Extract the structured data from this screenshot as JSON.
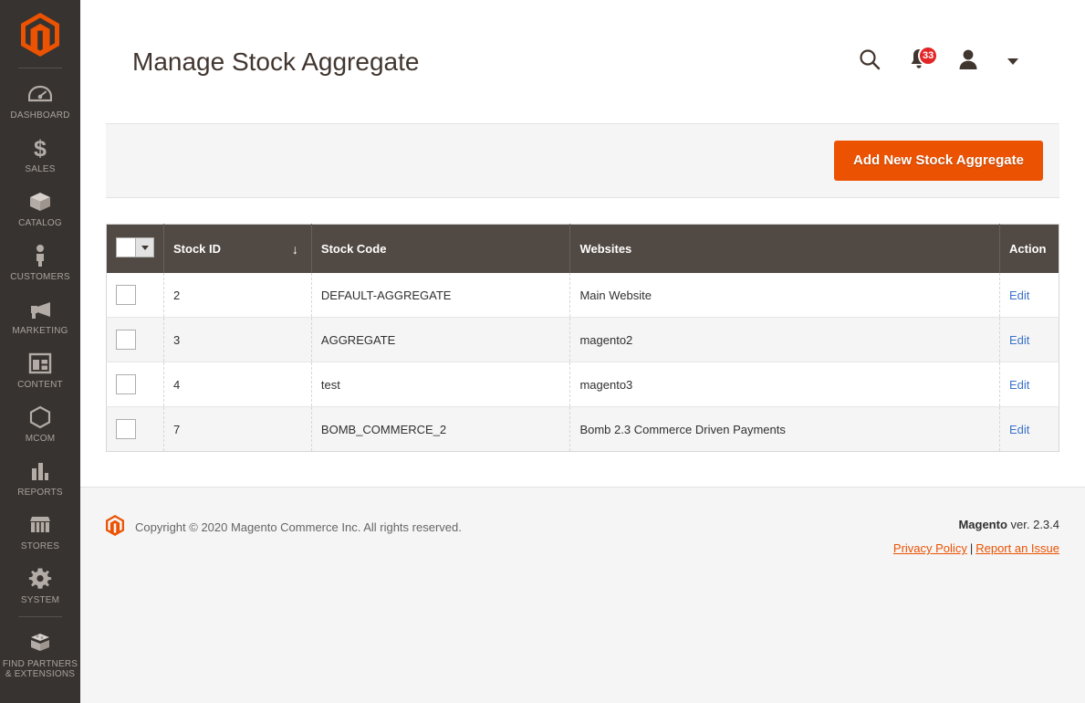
{
  "sidebar": {
    "logo": "magento-logo-icon",
    "items": [
      {
        "label": "Dashboard",
        "icon": "dashboard-icon",
        "name": "dashboard"
      },
      {
        "label": "Sales",
        "icon": "dollar-icon",
        "name": "sales"
      },
      {
        "label": "Catalog",
        "icon": "box-icon",
        "name": "catalog"
      },
      {
        "label": "Customers",
        "icon": "person-icon",
        "name": "customers"
      },
      {
        "label": "Marketing",
        "icon": "megaphone-icon",
        "name": "marketing"
      },
      {
        "label": "Content",
        "icon": "layout-icon",
        "name": "content"
      },
      {
        "label": "MCOM",
        "icon": "hexagon-icon",
        "name": "mcom"
      },
      {
        "label": "Reports",
        "icon": "bar-chart-icon",
        "name": "reports"
      },
      {
        "label": "Stores",
        "icon": "storefront-icon",
        "name": "stores"
      },
      {
        "label": "System",
        "icon": "gear-icon",
        "name": "system"
      },
      {
        "label": "Find Partners\n& Extensions",
        "icon": "bricks-icon",
        "name": "find-partners"
      }
    ]
  },
  "header": {
    "title": "Manage Stock Aggregate",
    "search_icon": "search-icon",
    "notifications_icon": "bell-icon",
    "notifications_count": "33",
    "account_icon": "user-icon",
    "caret_icon": "chevron-down-icon"
  },
  "toolbar": {
    "add_button_label": "Add New Stock Aggregate"
  },
  "grid": {
    "columns": [
      {
        "key": "check",
        "label": ""
      },
      {
        "key": "id",
        "label": "Stock ID",
        "sort": "↓"
      },
      {
        "key": "code",
        "label": "Stock Code"
      },
      {
        "key": "sites",
        "label": "Websites"
      },
      {
        "key": "action",
        "label": "Action"
      }
    ],
    "rows": [
      {
        "id": "2",
        "code": "DEFAULT-AGGREGATE",
        "sites": "Main Website",
        "action": "Edit"
      },
      {
        "id": "3",
        "code": "AGGREGATE",
        "sites": "magento2",
        "action": "Edit"
      },
      {
        "id": "4",
        "code": "test",
        "sites": "magento3",
        "action": "Edit"
      },
      {
        "id": "7",
        "code": "BOMB_COMMERCE_2",
        "sites": "Bomb 2.3 Commerce Driven Payments",
        "action": "Edit"
      }
    ]
  },
  "footer": {
    "copyright": "Copyright © 2020 Magento Commerce Inc. All rights reserved.",
    "brand": "Magento",
    "version": " ver. 2.3.4",
    "privacy_label": "Privacy Policy",
    "separator": "|",
    "report_label": "Report an Issue"
  },
  "colors": {
    "accent": "#eb5202",
    "sidebar_bg": "#373330",
    "grid_header_bg": "#514943",
    "link_blue": "#3a72c8",
    "badge_red": "#e22626"
  }
}
